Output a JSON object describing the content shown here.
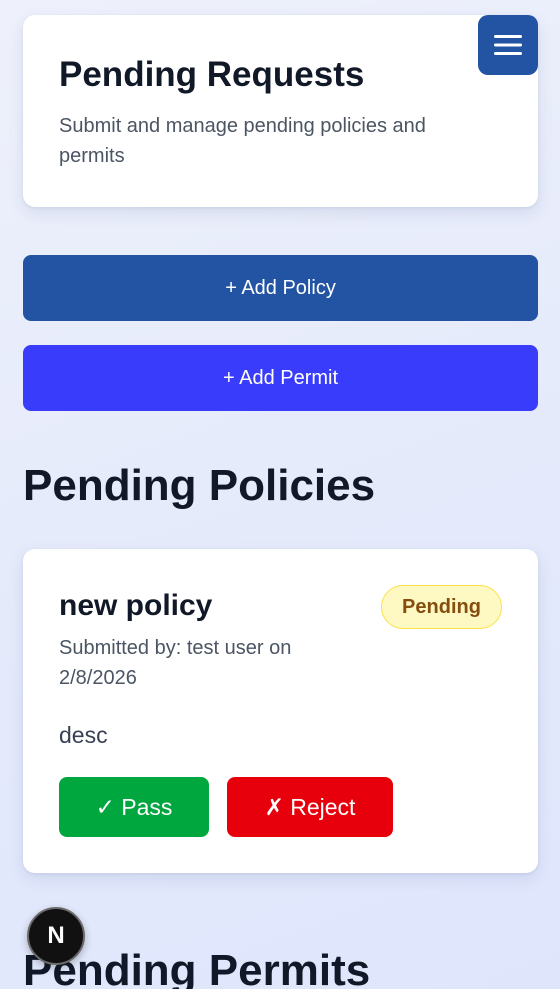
{
  "header": {
    "title": "Pending Requests",
    "subtitle": "Submit and manage pending policies and permits"
  },
  "menu": {
    "icon": "hamburger-menu-icon"
  },
  "actions": {
    "add_policy_label": "+ Add Policy",
    "add_permit_label": "+ Add Permit"
  },
  "sections": {
    "policies_heading": "Pending Policies",
    "permits_heading": "Pending Permits"
  },
  "policies": [
    {
      "title": "new policy",
      "status": "Pending",
      "meta": "Submitted by: test user on 2/8/2026",
      "description": "desc",
      "pass_label": "✓ Pass",
      "reject_label": "✗ Reject"
    }
  ],
  "dev_badge": {
    "letter": "N"
  },
  "colors": {
    "primary": "#2353a3",
    "permit": "#3a3cfb",
    "pass": "#00a63e",
    "reject": "#e7000b",
    "badge_bg": "#fef9c3",
    "badge_text": "#854d0e"
  }
}
